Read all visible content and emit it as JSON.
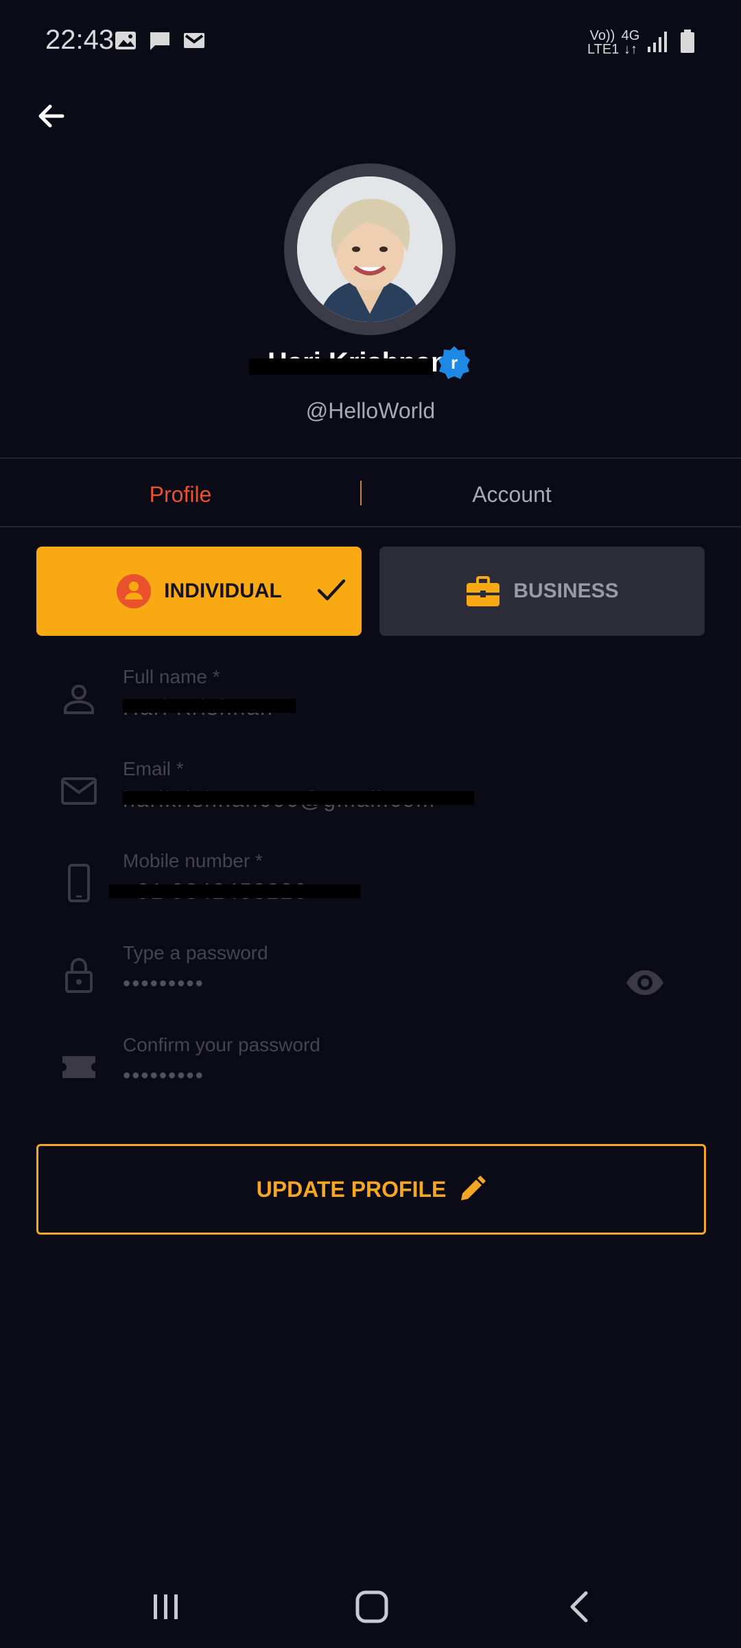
{
  "status_bar": {
    "time": "22:43",
    "network_top": "Vo))",
    "network_bottom": "LTE1",
    "network_type": "4G",
    "icons": [
      "image-icon",
      "message-icon",
      "gmail-icon",
      "signal-icon",
      "battery-icon"
    ]
  },
  "profile": {
    "display_name": "Hari Krishnan",
    "username": "@HelloWorld",
    "verified_badge_letter": "r"
  },
  "tabs": [
    {
      "label": "Profile",
      "active": true
    },
    {
      "label": "Account",
      "active": false
    }
  ],
  "account_type": {
    "individual_label": "INDIVIDUAL",
    "business_label": "BUSINESS",
    "selected": "INDIVIDUAL"
  },
  "form": {
    "full_name": {
      "label": "Full name *",
      "value": "Hari Krishnan"
    },
    "email": {
      "label": "Email *",
      "value": "harikrishnan666@gmail.com"
    },
    "mobile": {
      "label": "Mobile number *",
      "value": "+91 9842453226"
    },
    "password": {
      "label": "Type a password",
      "value": "•••••••••"
    },
    "confirm_password": {
      "label": "Confirm your password",
      "value": "•••••••••"
    }
  },
  "actions": {
    "update_label": "UPDATE PROFILE"
  },
  "colors": {
    "background": "#0b0a17",
    "accent_orange": "#f5a623",
    "active_tab": "#e8522c",
    "verified_blue": "#1e88e5"
  }
}
